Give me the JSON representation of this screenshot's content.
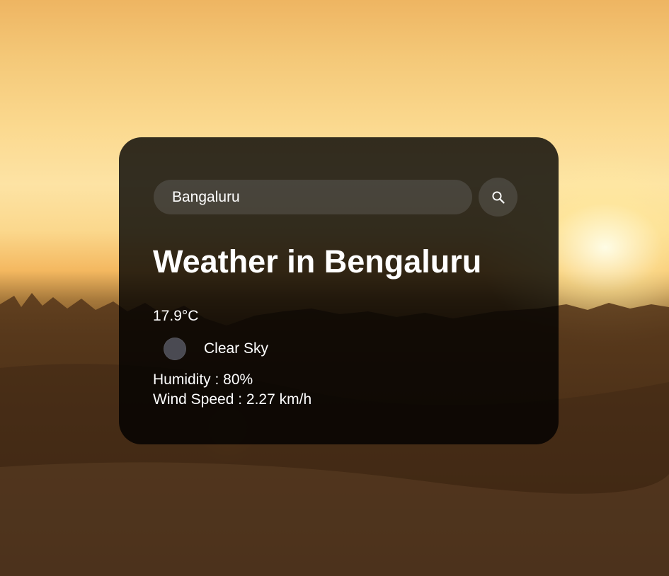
{
  "search": {
    "value": "Bangaluru",
    "icon": "search-icon"
  },
  "weather": {
    "title": "Weather in Bengaluru",
    "temperature": "17.9°C",
    "description": "Clear Sky",
    "icon": "weather-condition-icon",
    "humidity": "Humidity : 80%",
    "wind_speed": "Wind Speed : 2.27 km/h"
  },
  "colors": {
    "card_background": "#000000cc",
    "text": "#ffffff",
    "field_background": "#7c7c7c4d"
  }
}
